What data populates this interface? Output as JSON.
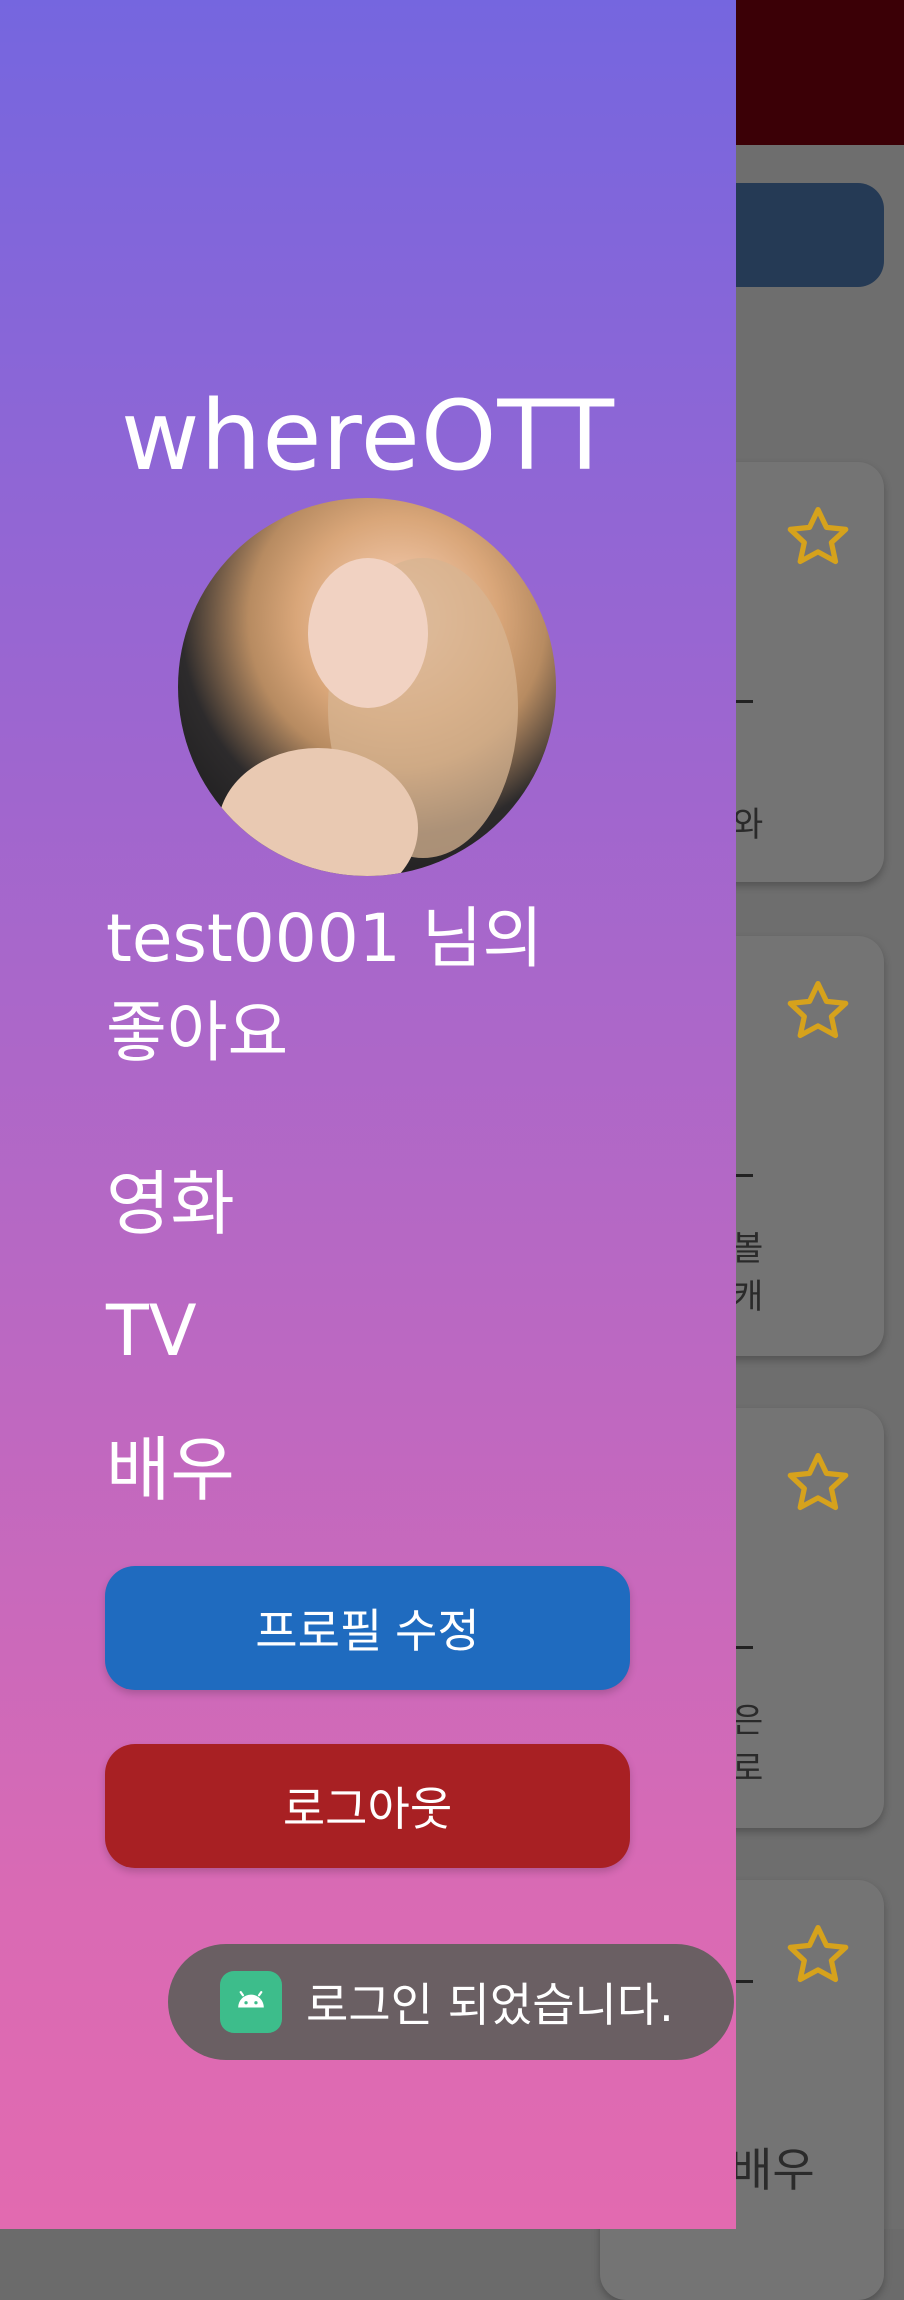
{
  "app": {
    "title": "whereOTT"
  },
  "drawer": {
    "user_line": "test0001 님의",
    "likes_label": "좋아요",
    "menu": [
      "영화",
      "TV",
      "배우"
    ],
    "edit_profile_button": "프로필 수정",
    "logout_button": "로그아웃"
  },
  "toast": {
    "message": "로그인 되었습니다."
  },
  "background": {
    "cards": [
      {
        "line1": "와",
        "line2": ""
      },
      {
        "line1": " 볼",
        "line2": "캐"
      },
      {
        "line1": "은",
        "line2": "로"
      },
      {
        "line1": "",
        "line2": ""
      }
    ],
    "bottom_text": "배우"
  },
  "colors": {
    "drawer_top": "#7566df",
    "drawer_bottom": "#e26ab0",
    "edit_button": "#1f6bbf",
    "logout_button": "#a82023",
    "star": "#d6a21c",
    "topbar": "#3b0006"
  },
  "icons": {
    "favorite": "star-outline-icon",
    "toast": "android-icon"
  }
}
